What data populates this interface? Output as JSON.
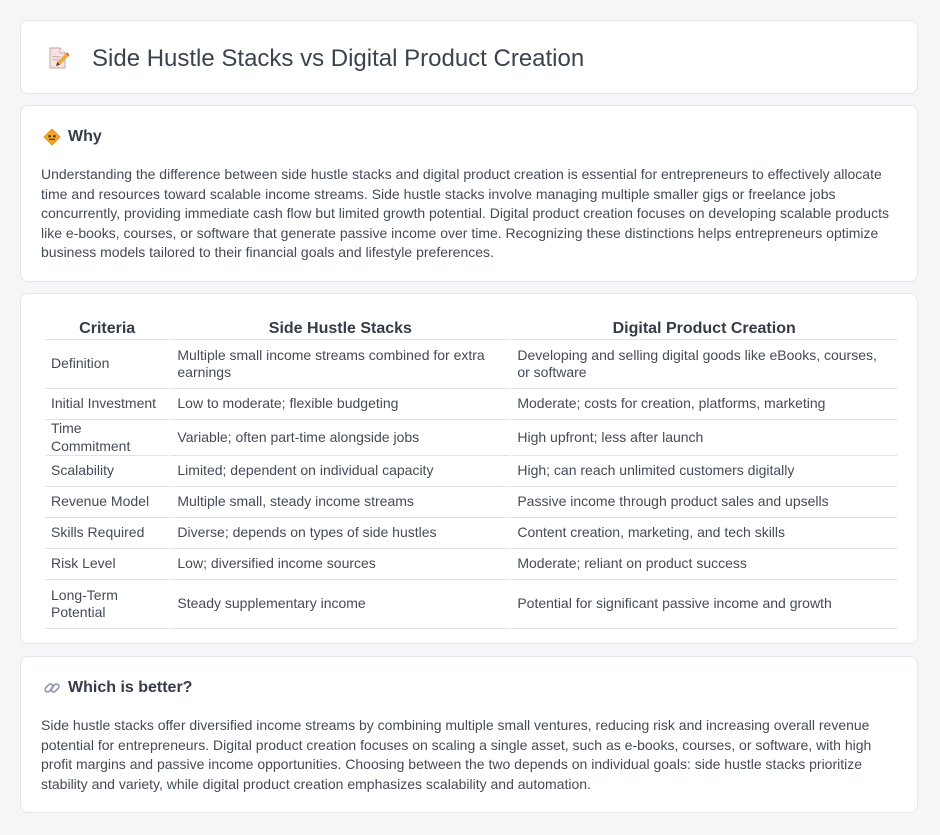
{
  "header": {
    "title": "Side Hustle Stacks vs Digital Product Creation",
    "icon": "pencil-document-icon"
  },
  "why": {
    "icon": "warning-diamond-icon",
    "title": "Why",
    "body": "Understanding the difference between side hustle stacks and digital product creation is essential for entrepreneurs to effectively allocate time and resources toward scalable income streams. Side hustle stacks involve managing multiple smaller gigs or freelance jobs concurrently, providing immediate cash flow but limited growth potential. Digital product creation focuses on developing scalable products like e-books, courses, or software that generate passive income over time. Recognizing these distinctions helps entrepreneurs optimize business models tailored to their financial goals and lifestyle preferences."
  },
  "table": {
    "headers": [
      "Criteria",
      "Side Hustle Stacks",
      "Digital Product Creation"
    ],
    "rows": [
      [
        "Definition",
        "Multiple small income streams combined for extra earnings",
        "Developing and selling digital goods like eBooks, courses, or software"
      ],
      [
        "Initial Investment",
        "Low to moderate; flexible budgeting",
        "Moderate; costs for creation, platforms, marketing"
      ],
      [
        "Time Commitment",
        "Variable; often part-time alongside jobs",
        "High upfront; less after launch"
      ],
      [
        "Scalability",
        "Limited; dependent on individual capacity",
        "High; can reach unlimited customers digitally"
      ],
      [
        "Revenue Model",
        "Multiple small, steady income streams",
        "Passive income through product sales and upsells"
      ],
      [
        "Skills Required",
        "Diverse; depends on types of side hustles",
        "Content creation, marketing, and tech skills"
      ],
      [
        "Risk Level",
        "Low; diversified income sources",
        "Moderate; reliant on product success"
      ],
      [
        "Long-Term Potential",
        "Steady supplementary income",
        "Potential for significant passive income and growth"
      ]
    ]
  },
  "better": {
    "icon": "link-icon",
    "title": "Which is better?",
    "body": "Side hustle stacks offer diversified income streams by combining multiple small ventures, reducing risk and increasing overall revenue potential for entrepreneurs. Digital product creation focuses on scaling a single asset, such as e-books, courses, or software, with high profit margins and passive income opportunities. Choosing between the two depends on individual goals: side hustle stacks prioritize stability and variety, while digital product creation emphasizes scalability and automation."
  }
}
